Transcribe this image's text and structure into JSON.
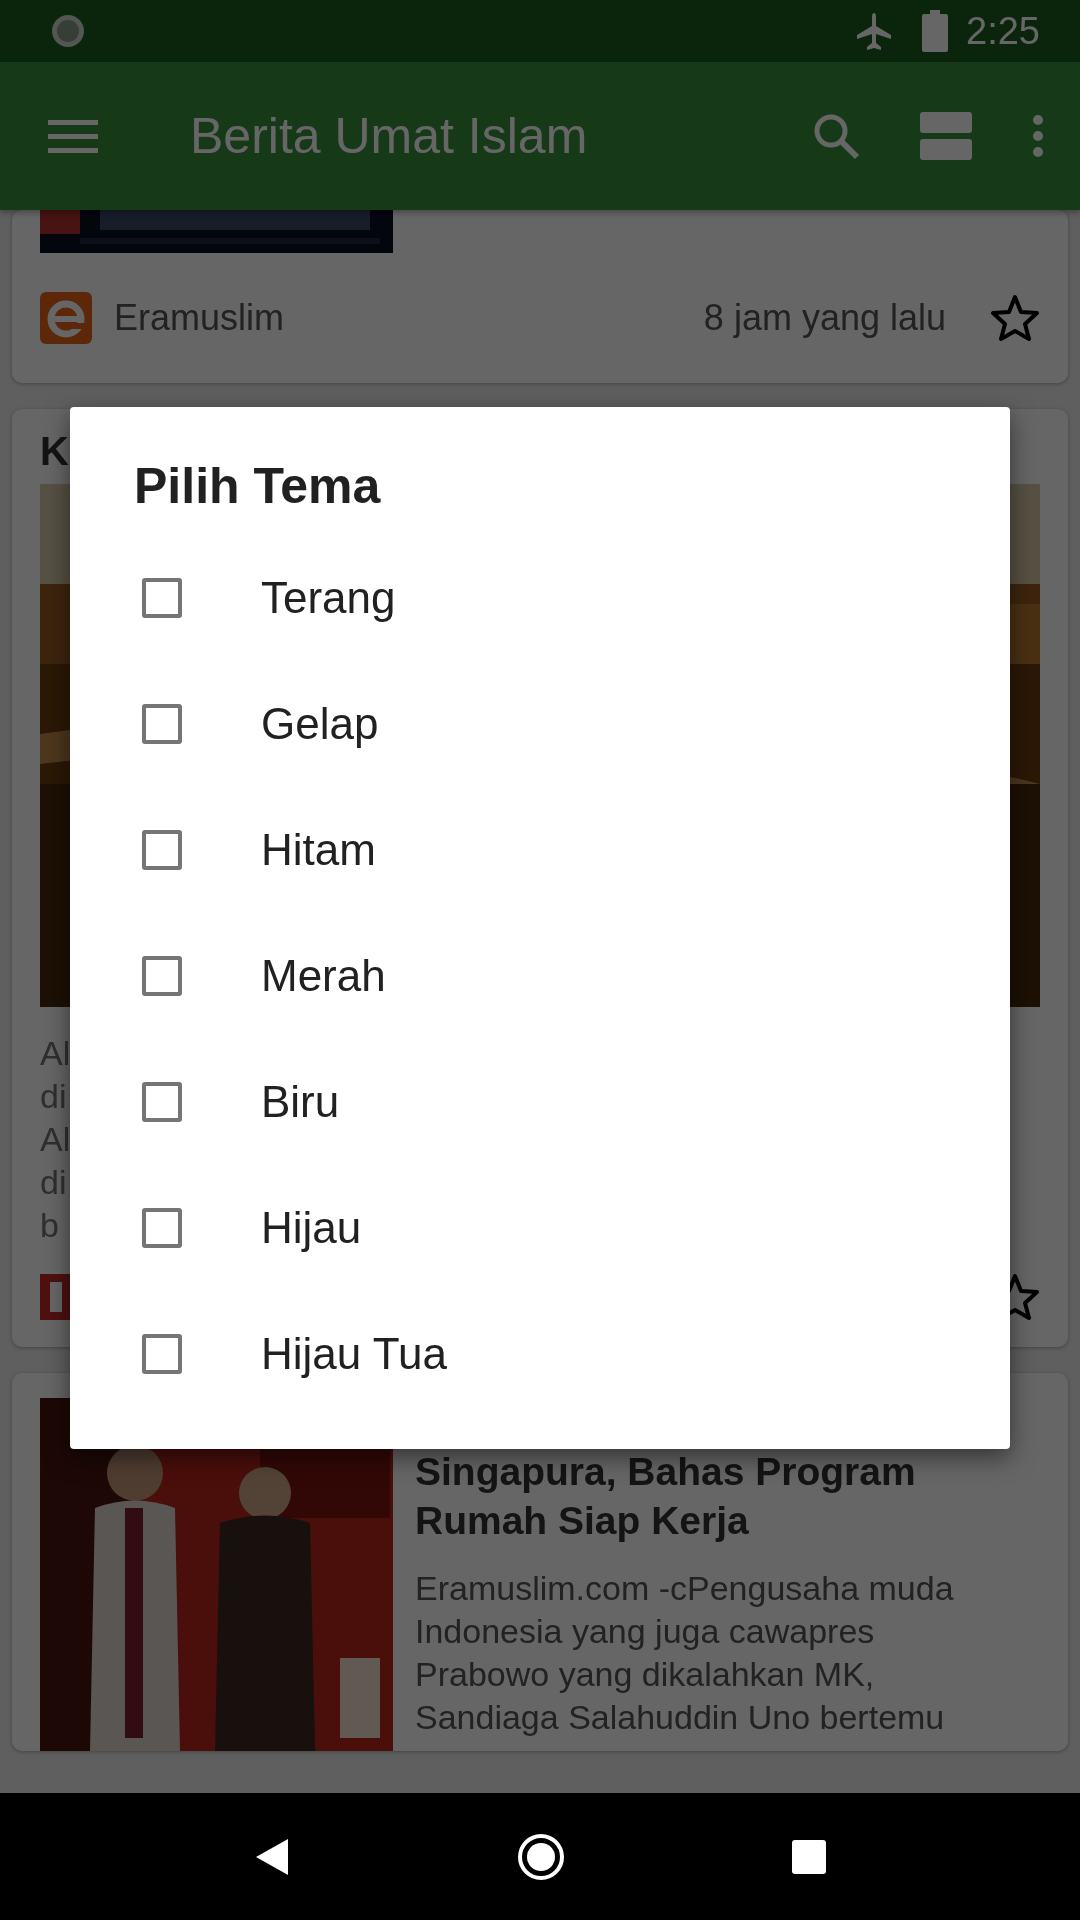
{
  "status_bar": {
    "time": "2:25"
  },
  "app_bar": {
    "title": "Berita Umat Islam"
  },
  "articles": [
    {
      "kind": "tail",
      "source": "Eramuslim",
      "time": "8 jam yang lalu",
      "starred": false
    },
    {
      "kind": "large",
      "title": "K",
      "snippet_lines": [
        "Al",
        "di",
        "Al",
        "di",
        "b"
      ],
      "starred": false
    },
    {
      "kind": "side",
      "title": "Singapura, Bahas Program Rumah Siap Kerja",
      "snippet": "Eramuslim.com -cPengusaha muda Indonesia yang juga cawapres Prabowo yang dikalahkan MK, Sandiaga Salahuddin Uno bertemu"
    }
  ],
  "dialog": {
    "title": "Pilih Tema",
    "options": [
      {
        "label": "Terang",
        "checked": false
      },
      {
        "label": "Gelap",
        "checked": false
      },
      {
        "label": "Hitam",
        "checked": false
      },
      {
        "label": "Merah",
        "checked": false
      },
      {
        "label": "Biru",
        "checked": false
      },
      {
        "label": "Hijau",
        "checked": false
      },
      {
        "label": "Hijau Tua",
        "checked": false
      }
    ]
  }
}
